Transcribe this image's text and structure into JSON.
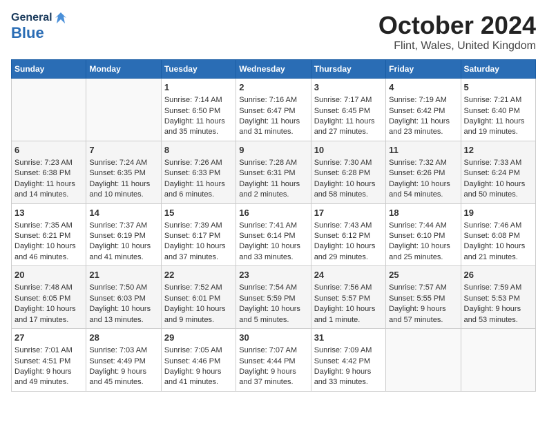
{
  "header": {
    "logo_general": "General",
    "logo_blue": "Blue",
    "month_title": "October 2024",
    "location": "Flint, Wales, United Kingdom"
  },
  "days_of_week": [
    "Sunday",
    "Monday",
    "Tuesday",
    "Wednesday",
    "Thursday",
    "Friday",
    "Saturday"
  ],
  "weeks": [
    [
      {
        "day": "",
        "info": ""
      },
      {
        "day": "",
        "info": ""
      },
      {
        "day": "1",
        "info": "Sunrise: 7:14 AM\nSunset: 6:50 PM\nDaylight: 11 hours and 35 minutes."
      },
      {
        "day": "2",
        "info": "Sunrise: 7:16 AM\nSunset: 6:47 PM\nDaylight: 11 hours and 31 minutes."
      },
      {
        "day": "3",
        "info": "Sunrise: 7:17 AM\nSunset: 6:45 PM\nDaylight: 11 hours and 27 minutes."
      },
      {
        "day": "4",
        "info": "Sunrise: 7:19 AM\nSunset: 6:42 PM\nDaylight: 11 hours and 23 minutes."
      },
      {
        "day": "5",
        "info": "Sunrise: 7:21 AM\nSunset: 6:40 PM\nDaylight: 11 hours and 19 minutes."
      }
    ],
    [
      {
        "day": "6",
        "info": "Sunrise: 7:23 AM\nSunset: 6:38 PM\nDaylight: 11 hours and 14 minutes."
      },
      {
        "day": "7",
        "info": "Sunrise: 7:24 AM\nSunset: 6:35 PM\nDaylight: 11 hours and 10 minutes."
      },
      {
        "day": "8",
        "info": "Sunrise: 7:26 AM\nSunset: 6:33 PM\nDaylight: 11 hours and 6 minutes."
      },
      {
        "day": "9",
        "info": "Sunrise: 7:28 AM\nSunset: 6:31 PM\nDaylight: 11 hours and 2 minutes."
      },
      {
        "day": "10",
        "info": "Sunrise: 7:30 AM\nSunset: 6:28 PM\nDaylight: 10 hours and 58 minutes."
      },
      {
        "day": "11",
        "info": "Sunrise: 7:32 AM\nSunset: 6:26 PM\nDaylight: 10 hours and 54 minutes."
      },
      {
        "day": "12",
        "info": "Sunrise: 7:33 AM\nSunset: 6:24 PM\nDaylight: 10 hours and 50 minutes."
      }
    ],
    [
      {
        "day": "13",
        "info": "Sunrise: 7:35 AM\nSunset: 6:21 PM\nDaylight: 10 hours and 46 minutes."
      },
      {
        "day": "14",
        "info": "Sunrise: 7:37 AM\nSunset: 6:19 PM\nDaylight: 10 hours and 41 minutes."
      },
      {
        "day": "15",
        "info": "Sunrise: 7:39 AM\nSunset: 6:17 PM\nDaylight: 10 hours and 37 minutes."
      },
      {
        "day": "16",
        "info": "Sunrise: 7:41 AM\nSunset: 6:14 PM\nDaylight: 10 hours and 33 minutes."
      },
      {
        "day": "17",
        "info": "Sunrise: 7:43 AM\nSunset: 6:12 PM\nDaylight: 10 hours and 29 minutes."
      },
      {
        "day": "18",
        "info": "Sunrise: 7:44 AM\nSunset: 6:10 PM\nDaylight: 10 hours and 25 minutes."
      },
      {
        "day": "19",
        "info": "Sunrise: 7:46 AM\nSunset: 6:08 PM\nDaylight: 10 hours and 21 minutes."
      }
    ],
    [
      {
        "day": "20",
        "info": "Sunrise: 7:48 AM\nSunset: 6:05 PM\nDaylight: 10 hours and 17 minutes."
      },
      {
        "day": "21",
        "info": "Sunrise: 7:50 AM\nSunset: 6:03 PM\nDaylight: 10 hours and 13 minutes."
      },
      {
        "day": "22",
        "info": "Sunrise: 7:52 AM\nSunset: 6:01 PM\nDaylight: 10 hours and 9 minutes."
      },
      {
        "day": "23",
        "info": "Sunrise: 7:54 AM\nSunset: 5:59 PM\nDaylight: 10 hours and 5 minutes."
      },
      {
        "day": "24",
        "info": "Sunrise: 7:56 AM\nSunset: 5:57 PM\nDaylight: 10 hours and 1 minute."
      },
      {
        "day": "25",
        "info": "Sunrise: 7:57 AM\nSunset: 5:55 PM\nDaylight: 9 hours and 57 minutes."
      },
      {
        "day": "26",
        "info": "Sunrise: 7:59 AM\nSunset: 5:53 PM\nDaylight: 9 hours and 53 minutes."
      }
    ],
    [
      {
        "day": "27",
        "info": "Sunrise: 7:01 AM\nSunset: 4:51 PM\nDaylight: 9 hours and 49 minutes."
      },
      {
        "day": "28",
        "info": "Sunrise: 7:03 AM\nSunset: 4:49 PM\nDaylight: 9 hours and 45 minutes."
      },
      {
        "day": "29",
        "info": "Sunrise: 7:05 AM\nSunset: 4:46 PM\nDaylight: 9 hours and 41 minutes."
      },
      {
        "day": "30",
        "info": "Sunrise: 7:07 AM\nSunset: 4:44 PM\nDaylight: 9 hours and 37 minutes."
      },
      {
        "day": "31",
        "info": "Sunrise: 7:09 AM\nSunset: 4:42 PM\nDaylight: 9 hours and 33 minutes."
      },
      {
        "day": "",
        "info": ""
      },
      {
        "day": "",
        "info": ""
      }
    ]
  ]
}
